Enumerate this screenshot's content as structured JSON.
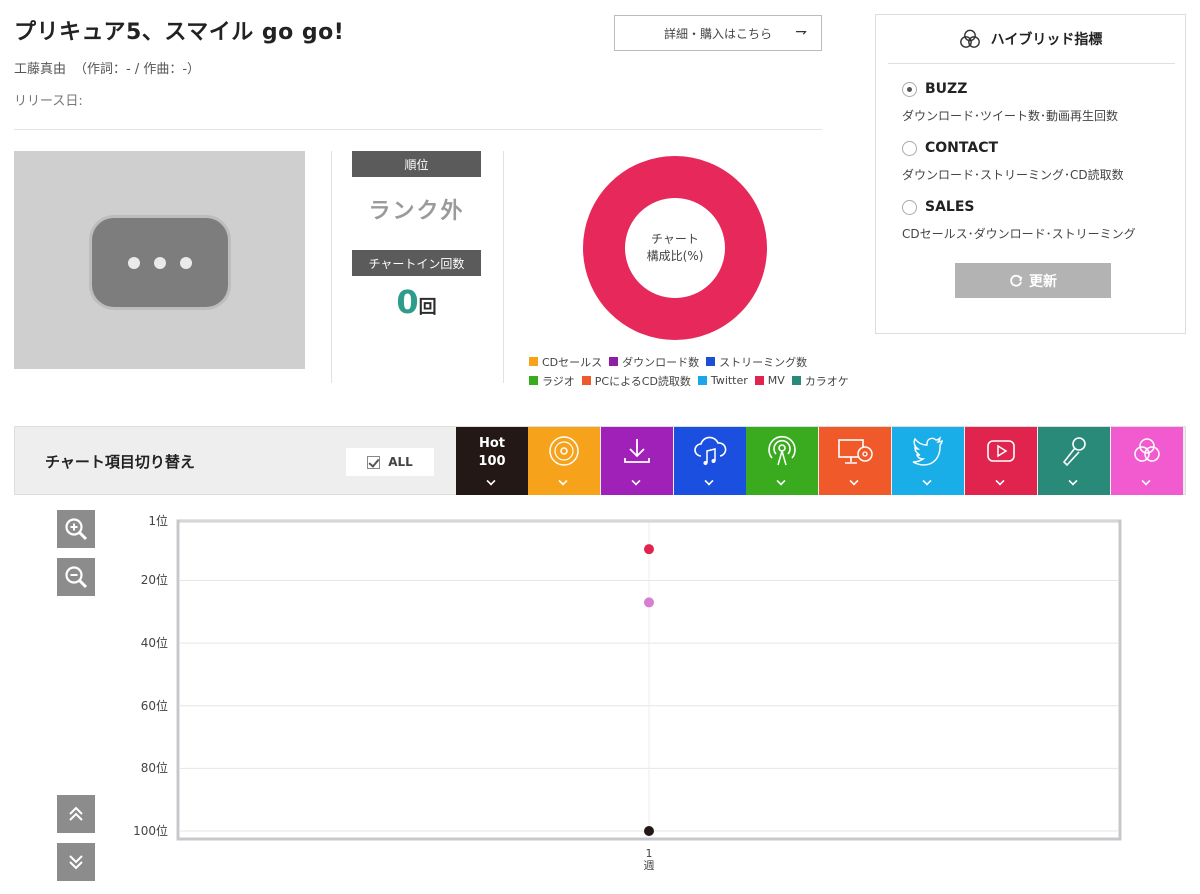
{
  "song": {
    "title": "プリキュア5、スマイル go go!",
    "artist": "工藤真由",
    "credits": "（作詞：- / 作曲：-）",
    "release": "リリース日:"
  },
  "buy_button": {
    "label": "詳細・購入はこちら",
    "arrow": "⇁"
  },
  "rank": {
    "label": "順位",
    "value": "ランク外"
  },
  "chart_in": {
    "label": "チャートイン回数",
    "value": "0",
    "unit": "回"
  },
  "composition": {
    "center_line1": "チャート",
    "center_line2": "構成比(%)",
    "ring_color": "#e6295a",
    "legend_row1": [
      {
        "label": "CDセールス",
        "color": "#f7a21b"
      },
      {
        "label": "ダウンロード数",
        "color": "#8e1fa3"
      },
      {
        "label": "ストリーミング数",
        "color": "#1a4fd6"
      }
    ],
    "legend_row2": [
      {
        "label": "ラジオ",
        "color": "#3aab1f"
      },
      {
        "label": "PCによるCD読取数",
        "color": "#f05a2a"
      },
      {
        "label": "Twitter",
        "color": "#1aa6e8"
      },
      {
        "label": "MV",
        "color": "#e0244e"
      },
      {
        "label": "カラオケ",
        "color": "#2a8a7a"
      }
    ]
  },
  "hybrid": {
    "title": "ハイブリッド指標",
    "options": [
      {
        "name": "BUZZ",
        "desc": "ダウンロード･ツイート数･動画再生回数",
        "selected": true
      },
      {
        "name": "CONTACT",
        "desc": "ダウンロード･ストリーミング･CD読取数",
        "selected": false
      },
      {
        "name": "SALES",
        "desc": "CDセールス･ダウンロード･ストリーミング",
        "selected": false
      }
    ],
    "refresh_label": "更新"
  },
  "switcher": {
    "label": "チャート項目切り替え",
    "all_label": "ALL",
    "hot_line1": "Hot",
    "hot_line2": "100",
    "tabs": [
      {
        "name": "hot100",
        "color": "#231815",
        "icon": "hot100-text"
      },
      {
        "name": "cd-sales",
        "color": "#f7a21b",
        "icon": "cd-disc-icon"
      },
      {
        "name": "download",
        "color": "#a021b8",
        "icon": "download-icon"
      },
      {
        "name": "streaming",
        "color": "#1a4fe0",
        "icon": "cloud-music-icon"
      },
      {
        "name": "radio",
        "color": "#3aab1f",
        "icon": "radio-antenna-icon"
      },
      {
        "name": "pc-cd-read",
        "color": "#f05a2a",
        "icon": "pc-disc-icon"
      },
      {
        "name": "twitter",
        "color": "#1aaee8",
        "icon": "twitter-bird-icon"
      },
      {
        "name": "mv",
        "color": "#e0244e",
        "icon": "play-video-icon"
      },
      {
        "name": "karaoke",
        "color": "#2a8a7a",
        "icon": "microphone-icon"
      },
      {
        "name": "hybrid",
        "color": "#f25bd0",
        "icon": "triple-circle-icon"
      }
    ]
  },
  "chart_data": {
    "type": "scatter",
    "y_inverted": true,
    "ylim": [
      1,
      100
    ],
    "y_ticks": [
      "1位",
      "20位",
      "40位",
      "60位",
      "80位",
      "100位"
    ],
    "y_tick_values": [
      1,
      20,
      40,
      60,
      80,
      100
    ],
    "x_ticks": [
      {
        "line1": "1",
        "line2": "週"
      }
    ],
    "grid": true,
    "series": [
      {
        "color": "#e0244e",
        "points": [
          {
            "x": 1,
            "y": 10
          }
        ]
      },
      {
        "color": "#d67fd0",
        "points": [
          {
            "x": 1,
            "y": 27
          }
        ]
      },
      {
        "color": "#231815",
        "points": [
          {
            "x": 1,
            "y": 100
          }
        ]
      }
    ]
  }
}
